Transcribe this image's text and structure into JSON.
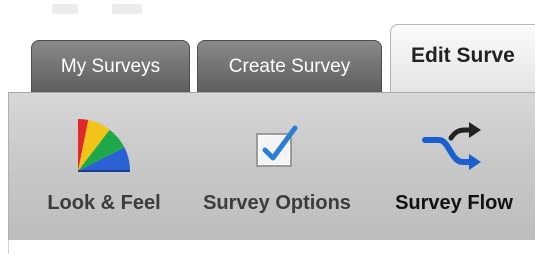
{
  "tabs": {
    "my_surveys": "My Surveys",
    "create_survey": "Create Survey",
    "edit_survey": "Edit Surve"
  },
  "toolbar": {
    "items": [
      {
        "label": "Look & Feel",
        "icon": "color-fan-icon"
      },
      {
        "label": "Survey Options",
        "icon": "checkbox-icon"
      },
      {
        "label": "Survey Flow",
        "icon": "shuffle-arrows-icon"
      }
    ]
  },
  "colors": {
    "tab_inactive": "#6f6f6f",
    "tab_active": "#f0f0f0",
    "toolbar_bg": "#c9c9c9",
    "checkmark": "#2a7fd4",
    "flow_arrow_blue": "#1a5fd0",
    "flow_arrow_black": "#222222"
  }
}
